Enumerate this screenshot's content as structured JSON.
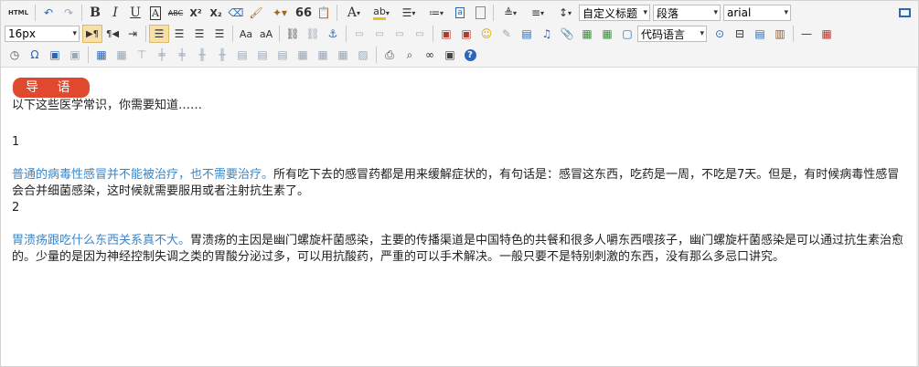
{
  "toolbar": {
    "row1": {
      "html_label": "HTML",
      "bold": "B",
      "italic": "I",
      "underline": "U",
      "strikethrough": "ABC",
      "superscript": "X²",
      "subscript": "X₂",
      "quote": "66",
      "font_color": "A",
      "highlight": "ab",
      "paragraph_format": "自定义标题",
      "paragraph_style": "段落",
      "font_family": "arial"
    },
    "row2": {
      "font_size": "16px",
      "code_language": "代码语言"
    }
  },
  "content": {
    "badge": "导 语",
    "intro": "以下这些医学常识，你需要知道……",
    "num1": "1",
    "p1_link": "普通的病毒性感冒并不能被治疗，也不需要治疗。",
    "p1_rest": "所有吃下去的感冒药都是用来缓解症状的，有句话是：感冒这东西，吃药是一周，不吃是7天。但是，有时候病毒性感冒会合并细菌感染，这时候就需要服用或者注射抗生素了。",
    "num2": "2",
    "p2_link": "胃溃疡跟吃什么东西关系真不大。",
    "p2_rest": "胃溃疡的主因是幽门螺旋杆菌感染，主要的传播渠道是中国特色的共餐和很多人嚼东西喂孩子，幽门螺旋杆菌感染是可以通过抗生素治愈的。少量的是因为神经控制失调之类的胃酸分泌过多，可以用抗酸药，严重的可以手术解决。一般只要不是特别刺激的东西，没有那么多忌口讲究。"
  },
  "colors": {
    "badge_bg": "#e1492e",
    "link_text": "#3a86c8",
    "active_button": "#f7e0a8"
  }
}
